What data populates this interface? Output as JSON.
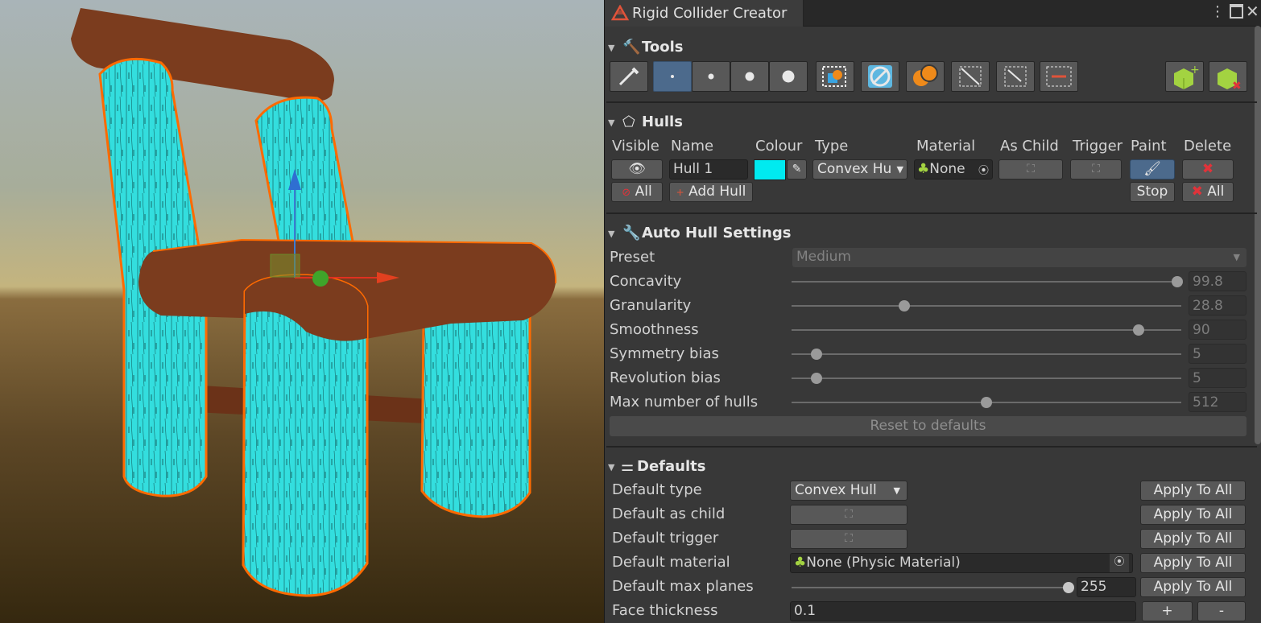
{
  "window": {
    "title": "Rigid Collider Creator",
    "menu_icon": "kebab-menu-icon",
    "maximize_icon": "maximize-icon",
    "close_icon": "close-icon"
  },
  "colors": {
    "hull_cyan": "#33dede",
    "highlight_orange": "#ff6a00",
    "wood_brown": "#7b3c1e",
    "panel_bg": "#383838",
    "selected_blue": "#4c6a8c"
  },
  "tools": {
    "title": "Tools",
    "buttons": [
      "eyedropper-icon",
      "brush-size-smallest-icon",
      "brush-size-small-icon",
      "brush-size-medium-icon",
      "brush-size-large-icon",
      "paint-colors-icon",
      "sphere-icon",
      "overlap-spheres-icon",
      "expand-icon",
      "shrink-icon",
      "bounds-icon",
      "add-box-collider-icon",
      "remove-box-collider-icon"
    ],
    "selected_index": 1
  },
  "hulls": {
    "title": "Hulls",
    "headers": {
      "visible": "Visible",
      "name": "Name",
      "colour": "Colour",
      "type": "Type",
      "material": "Material",
      "as_child": "As Child",
      "trigger": "Trigger",
      "paint": "Paint",
      "delete": "Delete"
    },
    "rows": [
      {
        "name": "Hull 1",
        "colour": "#00eaf0",
        "type": "Convex Hu",
        "material": "None"
      }
    ],
    "all_label": "All",
    "add_hull_label": "Add Hull",
    "stop_label": "Stop",
    "delete_all_label": "All"
  },
  "auto_hull": {
    "title": "Auto Hull Settings",
    "preset_label": "Preset",
    "preset_value": "Medium",
    "sliders": [
      {
        "label": "Concavity",
        "value": "99.8",
        "fraction": 0.99
      },
      {
        "label": "Granularity",
        "value": "28.8",
        "fraction": 0.29
      },
      {
        "label": "Smoothness",
        "value": "90",
        "fraction": 0.89
      },
      {
        "label": "Symmetry bias",
        "value": "5",
        "fraction": 0.065
      },
      {
        "label": "Revolution bias",
        "value": "5",
        "fraction": 0.065
      },
      {
        "label": "Max number of hulls",
        "value": "512",
        "fraction": 0.5
      }
    ],
    "reset_label": "Reset to defaults"
  },
  "defaults": {
    "title": "Defaults",
    "type_label": "Default type",
    "type_value": "Convex Hull",
    "as_child_label": "Default as child",
    "trigger_label": "Default trigger",
    "material_label": "Default material",
    "material_value": "None (Physic Material)",
    "max_planes_label": "Default max planes",
    "max_planes_value": "255",
    "max_planes_fraction": 1.0,
    "face_thickness_label": "Face thickness",
    "face_thickness_value": "0.1",
    "apply_label": "Apply To All",
    "plus_label": "+",
    "minus_label": "-"
  }
}
